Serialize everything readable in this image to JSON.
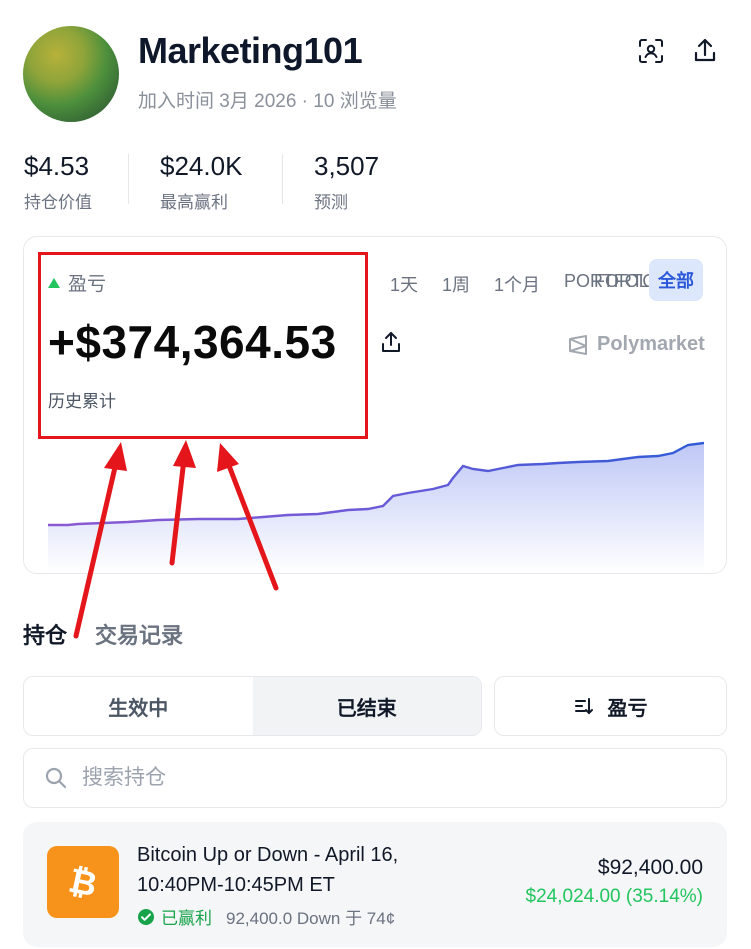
{
  "profile": {
    "username": "Marketing101",
    "joined": "加入时间 3月 2026 · 10 浏览量"
  },
  "stats": [
    {
      "value": "$4.53",
      "label": "持仓价值"
    },
    {
      "value": "$24.0K",
      "label": "最高赢利"
    },
    {
      "value": "3,507",
      "label": "预测"
    }
  ],
  "pnl": {
    "label": "盈亏",
    "value": "+$374,364.53",
    "sub": "历史累计",
    "ranges": [
      "1天",
      "1周",
      "1个月"
    ],
    "overlap_a": "PORTFOLIO",
    "overlap_b": "FORTOLIO",
    "range_all": "全部",
    "brand": "Polymarket"
  },
  "tabs": [
    "持仓",
    "交易记录"
  ],
  "segments": [
    "生效中",
    "已结束"
  ],
  "sort_label": "盈亏",
  "search": {
    "placeholder": "搜索持仓"
  },
  "position": {
    "title": "Bitcoin Up or Down - April 16, 10:40PM-10:45PM ET",
    "status": "已赢利",
    "detail": "92,400.0 Down 于 74¢",
    "amount": "$92,400.00",
    "gain": "$24,024.00 (35.14%)"
  },
  "colors": {
    "accent_blue": "#2b59d9",
    "gain_green": "#22c55e",
    "annotation_red": "#e4161b",
    "bitcoin_orange": "#f7931a"
  }
}
